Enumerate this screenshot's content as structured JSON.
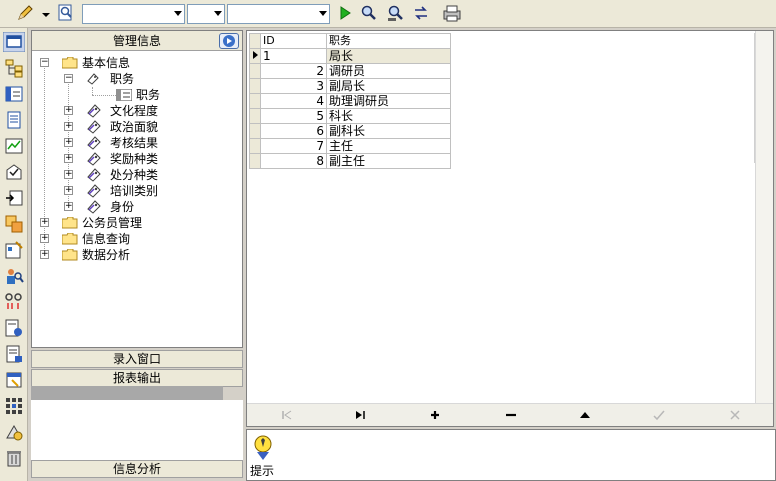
{
  "toolbar": {
    "combo1_value": "",
    "combo2_value": "",
    "combo3_value": ""
  },
  "tree": {
    "title": "管理信息",
    "root": "基本信息",
    "selected_group": "职务",
    "selected_leaf": "职务",
    "children": [
      "文化程度",
      "政治面貌",
      "考核结果",
      "奖励种类",
      "处分种类",
      "培训类别",
      "身份"
    ],
    "top_nodes": [
      "公务员管理",
      "信息查询",
      "数据分析"
    ]
  },
  "panels": {
    "entry_window": "录入窗口",
    "report_output": "报表输出",
    "info_analysis": "信息分析"
  },
  "grid": {
    "columns": [
      "ID",
      "职务"
    ],
    "rows": [
      {
        "id": "1",
        "name": "局长"
      },
      {
        "id": "2",
        "name": "调研员"
      },
      {
        "id": "3",
        "name": "副局长"
      },
      {
        "id": "4",
        "name": "助理调研员"
      },
      {
        "id": "5",
        "name": "科长"
      },
      {
        "id": "6",
        "name": "副科长"
      },
      {
        "id": "7",
        "name": "主任"
      },
      {
        "id": "8",
        "name": "副主任"
      }
    ]
  },
  "hint": {
    "label": "提示"
  },
  "colors": {
    "accent": "#316ac5",
    "panel": "#ece9d8"
  }
}
